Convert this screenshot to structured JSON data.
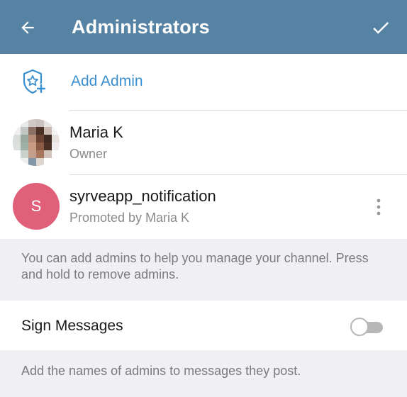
{
  "appbar": {
    "back_icon": "arrow-left-icon",
    "title": "Administrators",
    "confirm_icon": "checkmark-icon"
  },
  "add_admin": {
    "icon": "shield-star-plus-icon",
    "label": "Add Admin"
  },
  "admins": [
    {
      "name": "Maria K",
      "role": "Owner",
      "avatar": "photo"
    },
    {
      "name": "syrveapp_notification",
      "role": "Promoted by Maria K",
      "avatar_letter": "S",
      "avatar_color": "#e0607a",
      "menu_icon": "more-vertical-icon"
    }
  ],
  "admins_hint": "You can add admins to help you manage your channel. Press and hold to remove admins.",
  "sign_messages": {
    "label": "Sign Messages",
    "enabled": false
  },
  "sign_hint": "Add the names of admins to messages they post.",
  "colors": {
    "appbar": "#5682a3",
    "accent": "#3a8fcf",
    "background": "#efeff4"
  }
}
